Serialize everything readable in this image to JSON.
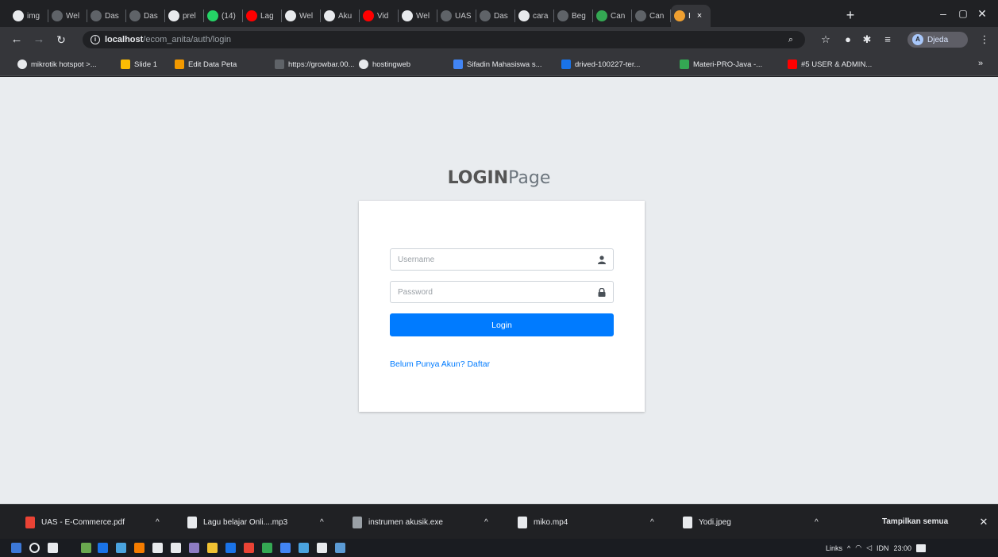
{
  "browser": {
    "tabs": [
      {
        "label": "img",
        "color": "#e8eaed"
      },
      {
        "label": "Wel",
        "color": "#5f6368"
      },
      {
        "label": "Das",
        "color": "#5f6368"
      },
      {
        "label": "Das",
        "color": "#5f6368"
      },
      {
        "label": "prel",
        "color": "#e8eaed"
      },
      {
        "label": "(14)",
        "color": "#25d366"
      },
      {
        "label": "Lag",
        "color": "#ff0000"
      },
      {
        "label": "Wel",
        "color": "#e8eaed"
      },
      {
        "label": "Aku",
        "color": "#e8eaed"
      },
      {
        "label": "Vid",
        "color": "#ff0000"
      },
      {
        "label": "Wel",
        "color": "#e8eaed"
      },
      {
        "label": "UAS",
        "color": "#5f6368"
      },
      {
        "label": "Das",
        "color": "#5f6368"
      },
      {
        "label": "cara",
        "color": "#e8eaed"
      },
      {
        "label": "Beg",
        "color": "#5f6368"
      },
      {
        "label": "Can",
        "color": "#34a853"
      },
      {
        "label": "Can",
        "color": "#5f6368"
      },
      {
        "label": "I",
        "color": "#f0a030"
      }
    ],
    "new_tab": "+",
    "window_controls": {
      "minimize": "–",
      "maximize": "▢",
      "close": "✕"
    },
    "url_host": "localhost",
    "url_path": "/ecom_anita/auth/login",
    "profile_name": "Djeda",
    "profile_initial": "A"
  },
  "bookmarks": [
    {
      "label": "mikrotik hotspot >...",
      "color": "#e8eaed"
    },
    {
      "label": "Slide 1",
      "color": "#fbbc04"
    },
    {
      "label": "Edit Data Peta",
      "color": "#f29900"
    },
    {
      "label": "https://growbar.00...",
      "color": "#5f6368"
    },
    {
      "label": "hostingweb",
      "color": "#e8eaed"
    },
    {
      "label": "Sifadin Mahasiswa s...",
      "color": "#4285f4"
    },
    {
      "label": "drived-100227-ter...",
      "color": "#1a73e8"
    },
    {
      "label": "Materi-PRO-Java -...",
      "color": "#34a853"
    },
    {
      "label": "#5 USER & ADMIN...",
      "color": "#ff0000"
    }
  ],
  "bookmarks_more": "»",
  "login": {
    "title_bold": "LOGIN",
    "title_light": "Page",
    "username_placeholder": "Username",
    "password_placeholder": "Password",
    "login_button": "Login",
    "register_link": "Belum Punya Akun? Daftar"
  },
  "downloads": [
    {
      "name": "UAS - E-Commerce.pdf",
      "color": "#ea4335"
    },
    {
      "name": "Lagu belajar Onli....mp3",
      "color": "#e8eaed"
    },
    {
      "name": "instrumen akusik.exe",
      "color": "#9aa0a6"
    },
    {
      "name": "miko.mp4",
      "color": "#e8eaed"
    },
    {
      "name": "Yodi.jpeg",
      "color": "#e8eaed"
    }
  ],
  "downloads_show_all": "Tampilkan semua",
  "downloads_close": "✕",
  "taskbar": {
    "icon_colors": [
      "#3c78d8",
      "#e8eaed",
      "#e8eaed",
      "#6aa84f",
      "#1a73e8",
      "#4aa3df",
      "#f57c00",
      "#e8eaed",
      "#e8eaed",
      "#8e7cc3",
      "#f1c232",
      "#1a73e8",
      "#ea4335",
      "#34a853",
      "#4285f4",
      "#4aa3df",
      "#e8eaed",
      "#5b9bd5"
    ],
    "tray_label": "Links",
    "tray_lang": "IDN",
    "clock": "23:00"
  }
}
